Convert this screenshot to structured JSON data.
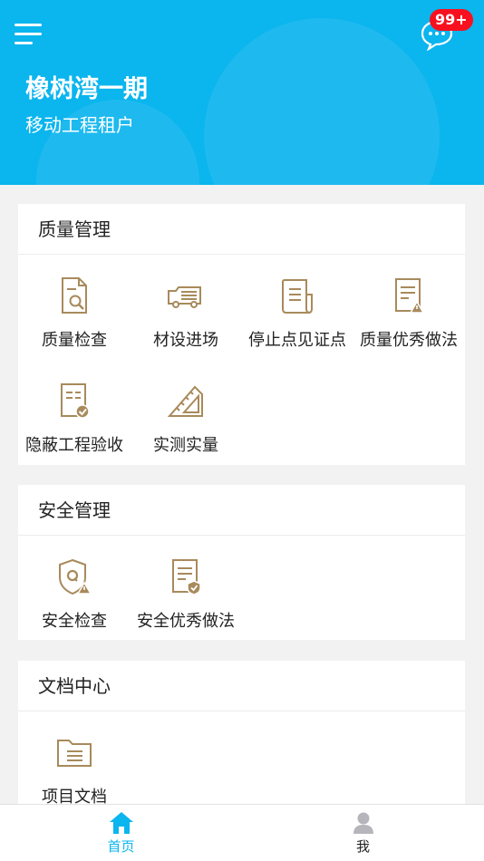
{
  "header": {
    "project_title": "橡树湾一期",
    "subtitle": "移动工程租户",
    "message_badge": "99+",
    "bg_color": "#0bb5ee"
  },
  "sections": [
    {
      "title": "质量管理",
      "items": [
        {
          "label": "质量检查",
          "icon": "document-search-icon"
        },
        {
          "label": "材设进场",
          "icon": "truck-icon"
        },
        {
          "label": "停止点见证点",
          "icon": "stop-point-document-icon"
        },
        {
          "label": "质量优秀做法",
          "icon": "document-warning-icon"
        },
        {
          "label": "隐蔽工程验收",
          "icon": "document-check-icon"
        },
        {
          "label": "实测实量",
          "icon": "ruler-icon"
        }
      ]
    },
    {
      "title": "安全管理",
      "items": [
        {
          "label": "安全检查",
          "icon": "shield-warning-icon"
        },
        {
          "label": "安全优秀做法",
          "icon": "document-shield-icon"
        }
      ]
    },
    {
      "title": "文档中心",
      "items": [
        {
          "label": "项目文档",
          "icon": "folder-document-icon"
        }
      ]
    }
  ],
  "tabbar": {
    "home_label": "首页",
    "me_label": "我",
    "active_color": "#0bb5ee",
    "inactive_color": "#222222"
  },
  "icon_color": "#a88a5c"
}
